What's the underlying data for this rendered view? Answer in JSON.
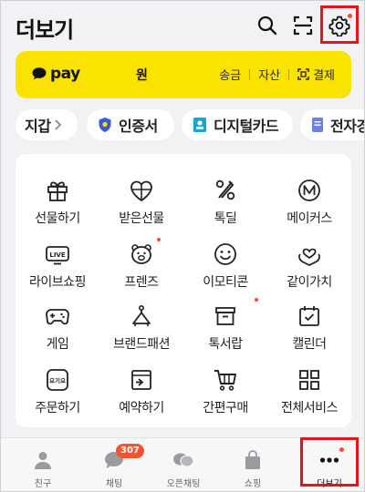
{
  "header": {
    "title": "더보기",
    "icons": [
      "search-icon",
      "scan-icon",
      "settings-icon"
    ]
  },
  "pay": {
    "logo_text": "pay",
    "balance_unit": "원",
    "links": [
      "송금",
      "자산",
      "결제"
    ]
  },
  "chips": [
    {
      "label": "지갑",
      "icon": "chevron-right-icon"
    },
    {
      "label": "인증서",
      "icon": "shield-icon"
    },
    {
      "label": "디지털카드",
      "icon": "id-card-icon"
    },
    {
      "label": "전자경",
      "icon": "document-icon"
    }
  ],
  "services": [
    {
      "label": "선물하기",
      "icon": "gift-box-icon"
    },
    {
      "label": "받은선물",
      "icon": "heart-gift-icon"
    },
    {
      "label": "톡딜",
      "icon": "percent-icon"
    },
    {
      "label": "메이커스",
      "icon": "makers-m-icon"
    },
    {
      "label": "라이브쇼핑",
      "icon": "live-tv-icon"
    },
    {
      "label": "프렌즈",
      "icon": "friends-bear-icon",
      "new": true
    },
    {
      "label": "이모티콘",
      "icon": "smile-icon"
    },
    {
      "label": "같이가치",
      "icon": "heart-hands-icon"
    },
    {
      "label": "게임",
      "icon": "gamepad-icon"
    },
    {
      "label": "브랜드패션",
      "icon": "hanger-icon"
    },
    {
      "label": "톡서랍",
      "icon": "drawer-icon",
      "new": true
    },
    {
      "label": "캘린더",
      "icon": "calendar-check-icon"
    },
    {
      "label": "주문하기",
      "icon": "order-icon"
    },
    {
      "label": "예약하기",
      "icon": "booking-icon"
    },
    {
      "label": "간편구매",
      "icon": "cart-icon"
    },
    {
      "label": "전체서비스",
      "icon": "grid-icon"
    }
  ],
  "order_icon_text": "요기요",
  "nav": {
    "items": [
      {
        "label": "친구",
        "icon": "person-icon"
      },
      {
        "label": "채팅",
        "icon": "chat-bubble-icon",
        "badge": "307"
      },
      {
        "label": "오픈채팅",
        "icon": "open-chat-icon"
      },
      {
        "label": "쇼핑",
        "icon": "shopping-bag-icon"
      },
      {
        "label": "더보기",
        "icon": "more-dots-icon",
        "active": true
      }
    ]
  },
  "colors": {
    "pay_yellow": "#fbe300",
    "highlight_red": "#e3141b",
    "badge_orange": "#f3542f"
  }
}
